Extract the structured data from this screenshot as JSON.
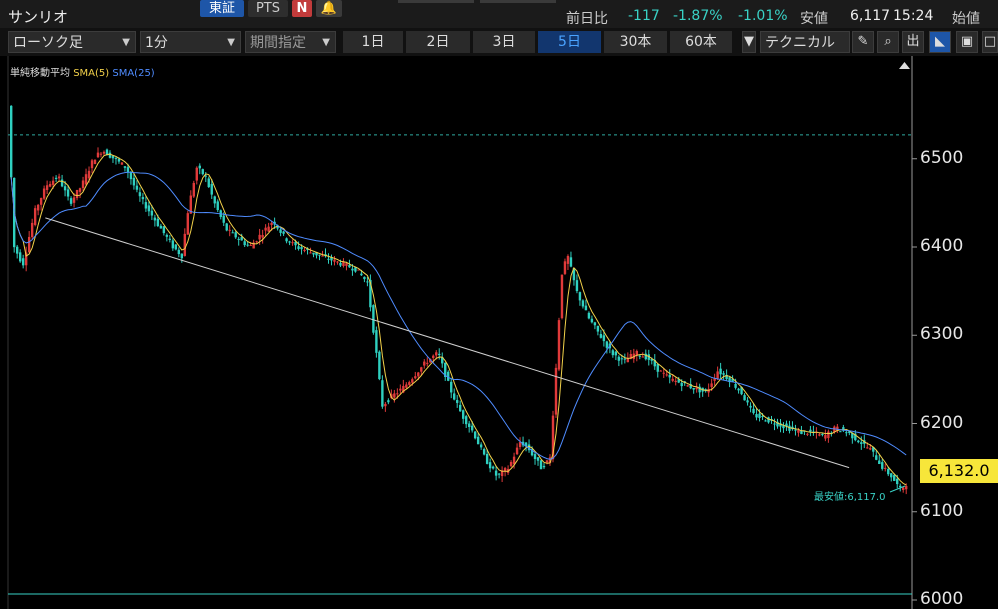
{
  "header": {
    "title": "サンリオ",
    "exchange_label": "東証",
    "pts_label": "PTS",
    "n_label": "N",
    "prev_diff_label": "前日比",
    "change": "-117",
    "change_pct": "-1.87%",
    "change_pct2": "-1.01%",
    "low_label": "安値",
    "low_value": "6,117",
    "time": "15:24",
    "open_label": "始値"
  },
  "toolbar": {
    "chart_type": "ローソク足",
    "interval": "1分",
    "period_select": "期間指定",
    "periods": [
      "1日",
      "2日",
      "3日",
      "5日",
      "30本",
      "60本"
    ],
    "active_period": "5日",
    "technical": "テクニカル",
    "output_label": "出"
  },
  "legend": {
    "title": "単純移動平均",
    "sma5": "SMA(5)",
    "sma25": "SMA(25)"
  },
  "colors": {
    "up": "#e03a3a",
    "down": "#2fd0c0",
    "sma5": "#f2d14a",
    "sma25": "#4f8cff",
    "trendline": "#cfcfcf",
    "accent": "#12366e",
    "price_box": "#f7e63a",
    "cyan": "#39d2c6"
  },
  "price_label": "6,132.0",
  "low_marker": "最安値:6,117.0",
  "chart_data": {
    "type": "candlestick",
    "y_ticks": [
      6000,
      6100,
      6200,
      6300,
      6400,
      6500
    ],
    "ylim": [
      5990,
      6590
    ],
    "reference_level": 6527,
    "last_price": 6132.0,
    "lowest": 6117.0,
    "path_points": [
      [
        0,
        6560
      ],
      [
        2,
        6400
      ],
      [
        5,
        6380
      ],
      [
        9,
        6440
      ],
      [
        13,
        6470
      ],
      [
        17,
        6480
      ],
      [
        21,
        6450
      ],
      [
        25,
        6470
      ],
      [
        29,
        6500
      ],
      [
        32,
        6510
      ],
      [
        36,
        6500
      ],
      [
        40,
        6490
      ],
      [
        44,
        6460
      ],
      [
        48,
        6440
      ],
      [
        52,
        6420
      ],
      [
        56,
        6400
      ],
      [
        59,
        6390
      ],
      [
        61,
        6440
      ],
      [
        64,
        6490
      ],
      [
        67,
        6480
      ],
      [
        70,
        6450
      ],
      [
        74,
        6420
      ],
      [
        78,
        6410
      ],
      [
        82,
        6400
      ],
      [
        86,
        6415
      ],
      [
        90,
        6430
      ],
      [
        94,
        6410
      ],
      [
        98,
        6400
      ],
      [
        102,
        6395
      ],
      [
        106,
        6390
      ],
      [
        110,
        6385
      ],
      [
        114,
        6380
      ],
      [
        118,
        6375
      ],
      [
        122,
        6360
      ],
      [
        125,
        6280
      ],
      [
        127,
        6220
      ],
      [
        130,
        6230
      ],
      [
        134,
        6240
      ],
      [
        138,
        6255
      ],
      [
        142,
        6270
      ],
      [
        146,
        6280
      ],
      [
        150,
        6240
      ],
      [
        154,
        6210
      ],
      [
        158,
        6190
      ],
      [
        162,
        6160
      ],
      [
        166,
        6140
      ],
      [
        170,
        6150
      ],
      [
        174,
        6180
      ],
      [
        177,
        6170
      ],
      [
        181,
        6150
      ],
      [
        184,
        6160
      ],
      [
        186,
        6260
      ],
      [
        188,
        6370
      ],
      [
        190,
        6390
      ],
      [
        193,
        6350
      ],
      [
        197,
        6320
      ],
      [
        201,
        6300
      ],
      [
        205,
        6280
      ],
      [
        209,
        6270
      ],
      [
        213,
        6280
      ],
      [
        217,
        6275
      ],
      [
        221,
        6260
      ],
      [
        225,
        6250
      ],
      [
        229,
        6245
      ],
      [
        233,
        6240
      ],
      [
        237,
        6235
      ],
      [
        241,
        6260
      ],
      [
        245,
        6250
      ],
      [
        249,
        6235
      ],
      [
        253,
        6210
      ],
      [
        257,
        6205
      ],
      [
        261,
        6200
      ],
      [
        265,
        6195
      ],
      [
        269,
        6190
      ],
      [
        273,
        6190
      ],
      [
        277,
        6185
      ],
      [
        281,
        6195
      ],
      [
        285,
        6190
      ],
      [
        289,
        6180
      ],
      [
        293,
        6170
      ],
      [
        297,
        6150
      ],
      [
        300,
        6140
      ],
      [
        303,
        6125
      ],
      [
        305,
        6132
      ]
    ],
    "trendline": [
      [
        12,
        6433
      ],
      [
        285,
        6150
      ]
    ]
  }
}
